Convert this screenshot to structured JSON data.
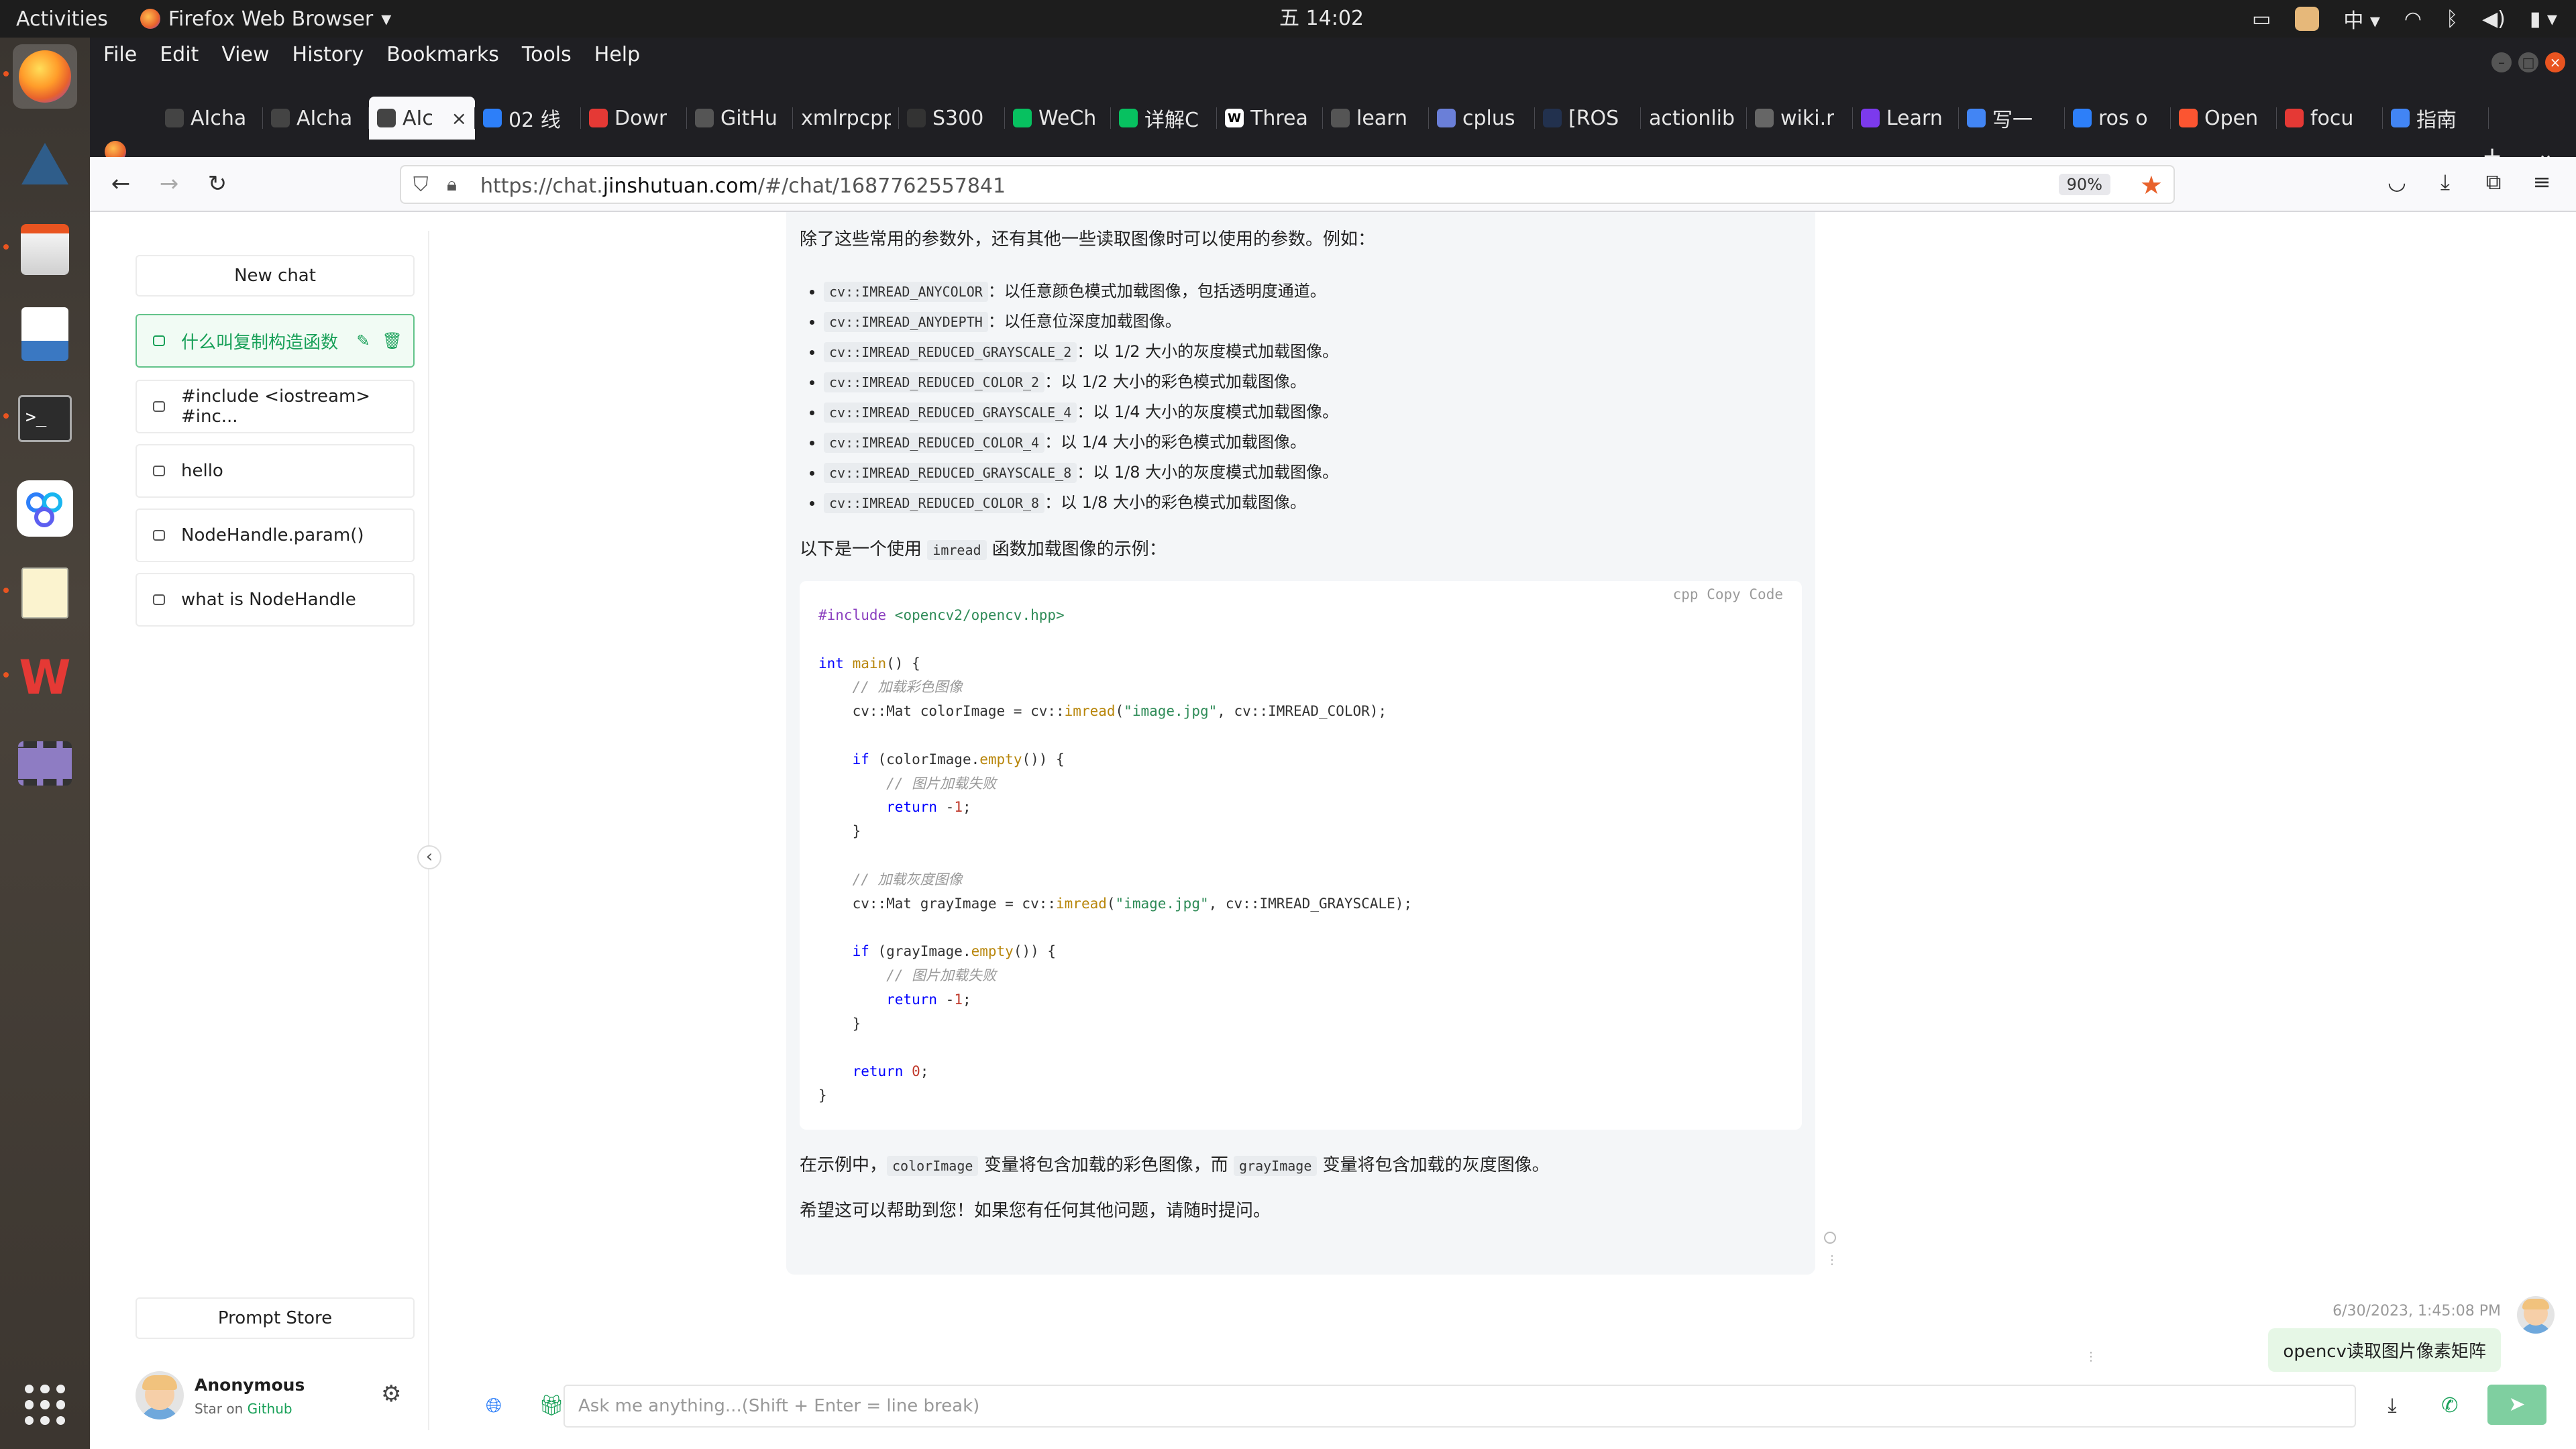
{
  "topbar": {
    "activities": "Activities",
    "app_name": "Firefox Web Browser",
    "clock": "五 14:02",
    "input_method": "中"
  },
  "menubar": {
    "items": [
      "File",
      "Edit",
      "View",
      "History",
      "Bookmarks",
      "Tools",
      "Help"
    ]
  },
  "tabs": [
    {
      "title": "AIcha",
      "icon": "chatgpt-icon",
      "active": false
    },
    {
      "title": "AIcha",
      "icon": "chatgpt-icon",
      "active": false
    },
    {
      "title": "AIc",
      "icon": "chatgpt-icon",
      "active": true
    },
    {
      "title": "02 线",
      "icon": "calendar-icon",
      "active": false
    },
    {
      "title": "Dowr",
      "icon": "download-site-icon",
      "active": false
    },
    {
      "title": "GitHu",
      "icon": "github-icon",
      "active": false
    },
    {
      "title": "xmlrpcpp",
      "icon": "",
      "active": false
    },
    {
      "title": "S300",
      "icon": "terminal-site-icon",
      "active": false
    },
    {
      "title": "WeCh",
      "icon": "wechat-icon",
      "active": false
    },
    {
      "title": "详解C",
      "icon": "wechat-icon",
      "active": false
    },
    {
      "title": "Threa",
      "icon": "wikipedia-icon",
      "active": false
    },
    {
      "title": "learn",
      "icon": "github-icon",
      "active": false
    },
    {
      "title": "cplus",
      "icon": "cplusplus-icon",
      "active": false
    },
    {
      "title": "[ROS",
      "icon": "ros-icon",
      "active": false
    },
    {
      "title": "actionlib",
      "icon": "",
      "active": false
    },
    {
      "title": "wiki.r",
      "icon": "info-icon",
      "active": false
    },
    {
      "title": "Learn",
      "icon": "shield-site-icon",
      "active": false
    },
    {
      "title": "写一",
      "icon": "google-icon",
      "active": false
    },
    {
      "title": "ros o",
      "icon": "grid-site-icon",
      "active": false
    },
    {
      "title": "Open",
      "icon": "csdn-icon",
      "active": false
    },
    {
      "title": "focu",
      "icon": "gear-site-icon",
      "active": false
    },
    {
      "title": "指南",
      "icon": "google-icon",
      "active": false
    }
  ],
  "navbar": {
    "url_prefix": "https://chat.",
    "url_domain": "jinshutuan.com",
    "url_suffix": "/#/chat/1687762557841",
    "zoom": "90%"
  },
  "sidebar": {
    "new_chat": "New chat",
    "history": [
      {
        "label": "什么叫复制构造函数",
        "active": true
      },
      {
        "label": "#include <iostream> #inc...",
        "active": false
      },
      {
        "label": "hello",
        "active": false
      },
      {
        "label": "NodeHandle.param()",
        "active": false
      },
      {
        "label": "what is NodeHandle",
        "active": false
      }
    ],
    "prompt_store": "Prompt Store",
    "user_name": "Anonymous",
    "user_sub_prefix": "Star on",
    "user_sub_link": "Github"
  },
  "message": {
    "intro": "除了这些常用的参数外，还有其他一些读取图像时可以使用的参数。例如：",
    "params": [
      {
        "code": "cv::IMREAD_ANYCOLOR",
        "desc": "：以任意颜色模式加载图像，包括透明度通道。"
      },
      {
        "code": "cv::IMREAD_ANYDEPTH",
        "desc": "：以任意位深度加载图像。"
      },
      {
        "code": "cv::IMREAD_REDUCED_GRAYSCALE_2",
        "desc": "：以 1/2 大小的灰度模式加载图像。"
      },
      {
        "code": "cv::IMREAD_REDUCED_COLOR_2",
        "desc": "：以 1/2 大小的彩色模式加载图像。"
      },
      {
        "code": "cv::IMREAD_REDUCED_GRAYSCALE_4",
        "desc": "：以 1/4 大小的灰度模式加载图像。"
      },
      {
        "code": "cv::IMREAD_REDUCED_COLOR_4",
        "desc": "：以 1/4 大小的彩色模式加载图像。"
      },
      {
        "code": "cv::IMREAD_REDUCED_GRAYSCALE_8",
        "desc": "：以 1/8 大小的灰度模式加载图像。"
      },
      {
        "code": "cv::IMREAD_REDUCED_COLOR_8",
        "desc": "：以 1/8 大小的彩色模式加载图像。"
      }
    ],
    "example_prefix": "以下是一个使用",
    "example_code": "imread",
    "example_suffix": "函数加载图像的示例：",
    "code_header": "cpp  Copy Code",
    "code_lines": [
      [
        [
          "pp",
          "#include "
        ],
        [
          "str",
          "<opencv2/opencv.hpp>"
        ]
      ],
      [],
      [
        [
          "kw",
          "int "
        ],
        [
          "fn",
          "main"
        ],
        [
          "",
          "() {"
        ]
      ],
      [
        [
          "",
          "    "
        ],
        [
          "cm",
          "// 加载彩色图像"
        ]
      ],
      [
        [
          "",
          "    cv::Mat colorImage = cv::"
        ],
        [
          "fn",
          "imread"
        ],
        [
          "",
          "("
        ],
        [
          "str",
          "\"image.jpg\""
        ],
        [
          "",
          ", cv::IMREAD_COLOR);"
        ]
      ],
      [],
      [
        [
          "",
          "    "
        ],
        [
          "kw",
          "if"
        ],
        [
          "",
          " (colorImage."
        ],
        [
          "fn",
          "empty"
        ],
        [
          "",
          "()) {"
        ]
      ],
      [
        [
          "",
          "        "
        ],
        [
          "cm",
          "// 图片加载失败"
        ]
      ],
      [
        [
          "",
          "        "
        ],
        [
          "kw",
          "return"
        ],
        [
          "",
          " -"
        ],
        [
          "num",
          "1"
        ],
        [
          "",
          ";"
        ]
      ],
      [
        [
          "",
          "    }"
        ]
      ],
      [],
      [
        [
          "",
          "    "
        ],
        [
          "cm",
          "// 加载灰度图像"
        ]
      ],
      [
        [
          "",
          "    cv::Mat grayImage = cv::"
        ],
        [
          "fn",
          "imread"
        ],
        [
          "",
          "("
        ],
        [
          "str",
          "\"image.jpg\""
        ],
        [
          "",
          ", cv::IMREAD_GRAYSCALE);"
        ]
      ],
      [],
      [
        [
          "",
          "    "
        ],
        [
          "kw",
          "if"
        ],
        [
          "",
          " (grayImage."
        ],
        [
          "fn",
          "empty"
        ],
        [
          "",
          "()) {"
        ]
      ],
      [
        [
          "",
          "        "
        ],
        [
          "cm",
          "// 图片加载失败"
        ]
      ],
      [
        [
          "",
          "        "
        ],
        [
          "kw",
          "return"
        ],
        [
          "",
          " -"
        ],
        [
          "num",
          "1"
        ],
        [
          "",
          ";"
        ]
      ],
      [
        [
          "",
          "    }"
        ]
      ],
      [],
      [
        [
          "",
          "    "
        ],
        [
          "kw",
          "return "
        ],
        [
          "num",
          "0"
        ],
        [
          "",
          ";"
        ]
      ],
      [
        [
          "",
          "}"
        ]
      ]
    ],
    "after_prefix": "在示例中，",
    "after_code1": "colorImage",
    "after_mid": "变量将包含加载的彩色图像，而",
    "after_code2": "grayImage",
    "after_suffix": "变量将包含加载的灰度图像。",
    "closing": "希望这可以帮助到您！如果您有任何其他问题，请随时提问。"
  },
  "user_message": {
    "time": "6/30/2023, 1:45:08 PM",
    "text": "opencv读取图片像素矩阵"
  },
  "input": {
    "placeholder": "Ask me anything...(Shift + Enter = line break)"
  },
  "colors": {
    "accent": "#18a058",
    "firefox_orange": "#e8622c",
    "ubuntu_orange": "#e95420"
  }
}
